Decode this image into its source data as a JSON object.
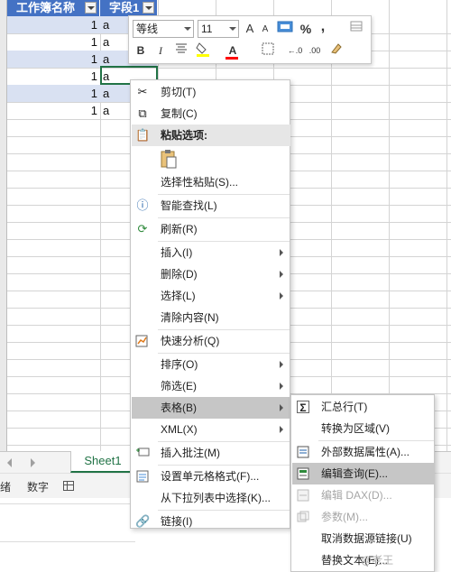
{
  "table": {
    "headers": [
      "工作簿名称",
      "字段1"
    ],
    "rows": [
      {
        "num": "1",
        "txt": "a"
      },
      {
        "num": "1",
        "txt": "a"
      },
      {
        "num": "1",
        "txt": "a"
      },
      {
        "num": "1",
        "txt": "a"
      },
      {
        "num": "1",
        "txt": "a"
      },
      {
        "num": "1",
        "txt": "a"
      }
    ]
  },
  "mini_toolbar": {
    "font_name": "等线",
    "font_size": "11",
    "percent": "%",
    "comma": ",",
    "bold": "B",
    "italic": "I",
    "font_color_glyph": "A",
    "increase_font": "A",
    "decrease_font": "A"
  },
  "context_menu": {
    "items": [
      {
        "label": "剪切(T)",
        "icon": "scissors-icon"
      },
      {
        "label": "复制(C)",
        "icon": "copy-icon"
      },
      {
        "label": "粘贴选项:",
        "icon": "paste-icon"
      },
      {
        "label": "选择性粘贴(S)...",
        "icon": ""
      },
      {
        "label": "智能查找(L)",
        "icon": "smart-lookup-icon"
      },
      {
        "label": "刷新(R)",
        "icon": "refresh-icon"
      },
      {
        "label": "插入(I)",
        "icon": ""
      },
      {
        "label": "删除(D)",
        "icon": ""
      },
      {
        "label": "选择(L)",
        "icon": ""
      },
      {
        "label": "清除内容(N)",
        "icon": ""
      },
      {
        "label": "快速分析(Q)",
        "icon": "quick-analysis-icon"
      },
      {
        "label": "排序(O)",
        "icon": ""
      },
      {
        "label": "筛选(E)",
        "icon": ""
      },
      {
        "label": "表格(B)",
        "icon": ""
      },
      {
        "label": "XML(X)",
        "icon": ""
      },
      {
        "label": "插入批注(M)",
        "icon": "comment-icon"
      },
      {
        "label": "设置单元格格式(F)...",
        "icon": "format-cells-icon"
      },
      {
        "label": "从下拉列表中选择(K)...",
        "icon": ""
      },
      {
        "label": "链接(I)",
        "icon": "link-icon"
      }
    ]
  },
  "submenu": {
    "items": [
      {
        "label": "汇总行(T)",
        "icon": "sigma-icon"
      },
      {
        "label": "转换为区域(V)",
        "icon": ""
      },
      {
        "label": "外部数据属性(A)...",
        "icon": "properties-icon"
      },
      {
        "label": "编辑查询(E)...",
        "icon": "edit-query-icon"
      },
      {
        "label": "编辑 DAX(D)...",
        "icon": "dax-icon"
      },
      {
        "label": "参数(M)...",
        "icon": "parameters-icon"
      },
      {
        "label": "取消数据源链接(U)",
        "icon": ""
      },
      {
        "label": "替换文本(E)...",
        "icon": ""
      }
    ]
  },
  "sheet_tab": "Sheet1",
  "status": {
    "ready": "绪",
    "num_format": "数字"
  },
  "watermark": "@老王"
}
